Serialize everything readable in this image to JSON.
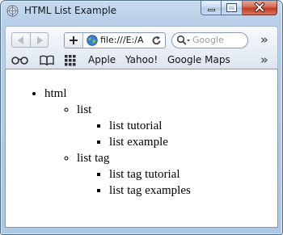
{
  "window": {
    "title": "HTML List Example"
  },
  "nav": {
    "add_label": "+",
    "url": "file:///E:/A",
    "search_placeholder": "Google",
    "overflow": "»"
  },
  "bookmarks": {
    "items": [
      {
        "label": "Apple"
      },
      {
        "label": "Yahoo!"
      },
      {
        "label": "Google Maps"
      }
    ],
    "overflow": "»"
  },
  "page": {
    "list": {
      "label": "html",
      "children": [
        {
          "label": "list",
          "children": [
            {
              "label": "list tutorial"
            },
            {
              "label": "list example"
            }
          ]
        },
        {
          "label": "list tag",
          "children": [
            {
              "label": "list tag tutorial"
            },
            {
              "label": "list tag examples"
            }
          ]
        }
      ]
    }
  },
  "icons": {
    "title": "browser-globe-icon",
    "back": "back-arrow-icon",
    "forward": "forward-arrow-icon",
    "globe": "globe-icon",
    "reload": "reload-icon",
    "search": "search-icon",
    "reading_list": "reading-list-icon",
    "bookmarks": "bookmarks-book-icon",
    "top_sites": "top-sites-grid-icon"
  },
  "colors": {
    "frame": "#b9cfe8",
    "close_button": "#c13b22",
    "accent_globe": "#2f6fc2"
  }
}
